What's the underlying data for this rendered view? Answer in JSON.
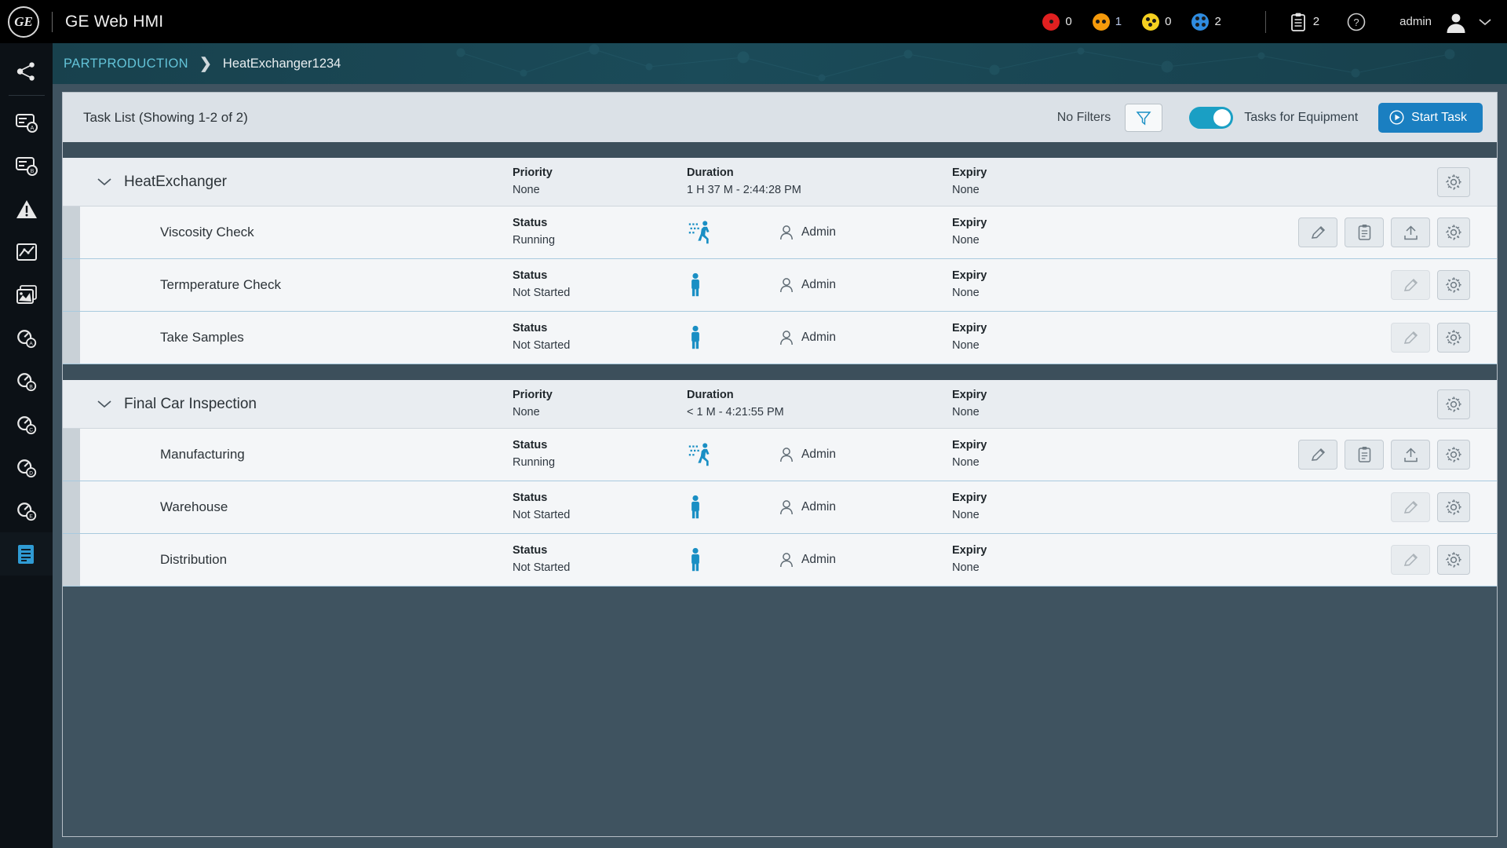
{
  "header": {
    "logo_text": "GE",
    "app_title": "GE Web HMI",
    "alarms": [
      {
        "icon": "alarm-critical-icon",
        "color": "#e02020",
        "count": "0",
        "dots": 1
      },
      {
        "icon": "alarm-high-icon",
        "color": "#f59a0b",
        "count": "1",
        "dots": 2
      },
      {
        "icon": "alarm-medium-icon",
        "color": "#f5d020",
        "count": "0",
        "dots": 3
      },
      {
        "icon": "alarm-low-icon",
        "color": "#2f8ce0",
        "count": "2",
        "dots": 4
      }
    ],
    "clipboard": {
      "icon": "clipboard-icon",
      "count": "2"
    },
    "help": {
      "icon": "help-circle-icon"
    },
    "user": {
      "name": "admin",
      "avatar_icon": "user-avatar-icon",
      "chevron_icon": "chevron-down-icon"
    }
  },
  "sidebar": {
    "items": [
      {
        "name": "sidebar-item-share",
        "icon": "share-network-icon"
      },
      {
        "name": "sidebar-item-list-a",
        "icon": "list-a-icon"
      },
      {
        "name": "sidebar-item-list-b",
        "icon": "list-b-icon"
      },
      {
        "name": "sidebar-item-alarms",
        "icon": "alert-triangle-icon"
      },
      {
        "name": "sidebar-item-trend",
        "icon": "trend-chart-icon"
      },
      {
        "name": "sidebar-item-images",
        "icon": "image-stack-icon"
      },
      {
        "name": "sidebar-item-gauge-a",
        "icon": "gauge-a-icon"
      },
      {
        "name": "sidebar-item-gauge-b",
        "icon": "gauge-b-icon"
      },
      {
        "name": "sidebar-item-gauge-c",
        "icon": "gauge-c-icon"
      },
      {
        "name": "sidebar-item-gauge-d",
        "icon": "gauge-d-icon"
      },
      {
        "name": "sidebar-item-gauge-e",
        "icon": "gauge-e-icon"
      },
      {
        "name": "sidebar-item-tasks",
        "icon": "task-list-icon",
        "active": true
      }
    ]
  },
  "breadcrumb": {
    "root": "PARTPRODUCTION",
    "separator": "❯",
    "leaf": "HeatExchanger1234"
  },
  "toolbar": {
    "title": "Task List (Showing 1-2 of 2)",
    "no_filters_label": "No Filters",
    "filter_icon": "filter-funnel-icon",
    "toggle_on": true,
    "toggle_label": "Tasks for Equipment",
    "start_label": "Start Task",
    "start_icon": "play-circle-icon"
  },
  "columns": {
    "priority": "Priority",
    "duration": "Duration",
    "expiry": "Expiry",
    "status": "Status"
  },
  "groups": [
    {
      "name": "HeatExchanger",
      "chevron_icon": "chevron-down-icon",
      "priority": "None",
      "duration": "1 H 37 M - 2:44:28 PM",
      "expiry": "None",
      "gear_icon": "gear-icon",
      "tasks": [
        {
          "name": "Viscosity Check",
          "status": "Running",
          "status_icon": "running-person-icon",
          "owner": "Admin",
          "owner_icon": "person-icon",
          "expiry": "None",
          "actions": [
            {
              "name": "edit-button",
              "icon": "pencil-icon",
              "disabled": false
            },
            {
              "name": "checklist-button",
              "icon": "clipboard-list-icon",
              "disabled": false
            },
            {
              "name": "upload-button",
              "icon": "upload-icon",
              "disabled": false
            },
            {
              "name": "settings-button",
              "icon": "gear-icon",
              "disabled": false
            }
          ]
        },
        {
          "name": "Termperature Check",
          "status": "Not Started",
          "status_icon": "standing-person-icon",
          "owner": "Admin",
          "owner_icon": "person-icon",
          "expiry": "None",
          "actions": [
            {
              "name": "edit-button",
              "icon": "pencil-icon",
              "disabled": true
            },
            {
              "name": "settings-button",
              "icon": "gear-icon",
              "disabled": false
            }
          ]
        },
        {
          "name": "Take Samples",
          "status": "Not Started",
          "status_icon": "standing-person-icon",
          "owner": "Admin",
          "owner_icon": "person-icon",
          "expiry": "None",
          "actions": [
            {
              "name": "edit-button",
              "icon": "pencil-icon",
              "disabled": true
            },
            {
              "name": "settings-button",
              "icon": "gear-icon",
              "disabled": false
            }
          ]
        }
      ]
    },
    {
      "name": "Final Car Inspection",
      "chevron_icon": "chevron-down-icon",
      "priority": "None",
      "duration": "< 1 M  - 4:21:55 PM",
      "expiry": "None",
      "gear_icon": "gear-icon",
      "tasks": [
        {
          "name": "Manufacturing",
          "status": "Running",
          "status_icon": "running-person-icon",
          "owner": "Admin",
          "owner_icon": "person-icon",
          "expiry": "None",
          "actions": [
            {
              "name": "edit-button",
              "icon": "pencil-icon",
              "disabled": false
            },
            {
              "name": "checklist-button",
              "icon": "clipboard-list-icon",
              "disabled": false
            },
            {
              "name": "upload-button",
              "icon": "upload-icon",
              "disabled": false
            },
            {
              "name": "settings-button",
              "icon": "gear-icon",
              "disabled": false
            }
          ]
        },
        {
          "name": "Warehouse",
          "status": "Not Started",
          "status_icon": "standing-person-icon",
          "owner": "Admin",
          "owner_icon": "person-icon",
          "expiry": "None",
          "actions": [
            {
              "name": "edit-button",
              "icon": "pencil-icon",
              "disabled": true
            },
            {
              "name": "settings-button",
              "icon": "gear-icon",
              "disabled": false
            }
          ]
        },
        {
          "name": "Distribution",
          "status": "Not Started",
          "status_icon": "standing-person-icon",
          "owner": "Admin",
          "owner_icon": "person-icon",
          "expiry": "None",
          "actions": [
            {
              "name": "edit-button",
              "icon": "pencil-icon",
              "disabled": true
            },
            {
              "name": "settings-button",
              "icon": "gear-icon",
              "disabled": false
            }
          ]
        }
      ]
    }
  ],
  "colors": {
    "accent_teal": "#1a9fc4",
    "accent_blue": "#1a7fc1",
    "breadcrumb_link": "#63c3d8",
    "header_bg": "#000000",
    "panel_bg": "#dde3e8"
  }
}
